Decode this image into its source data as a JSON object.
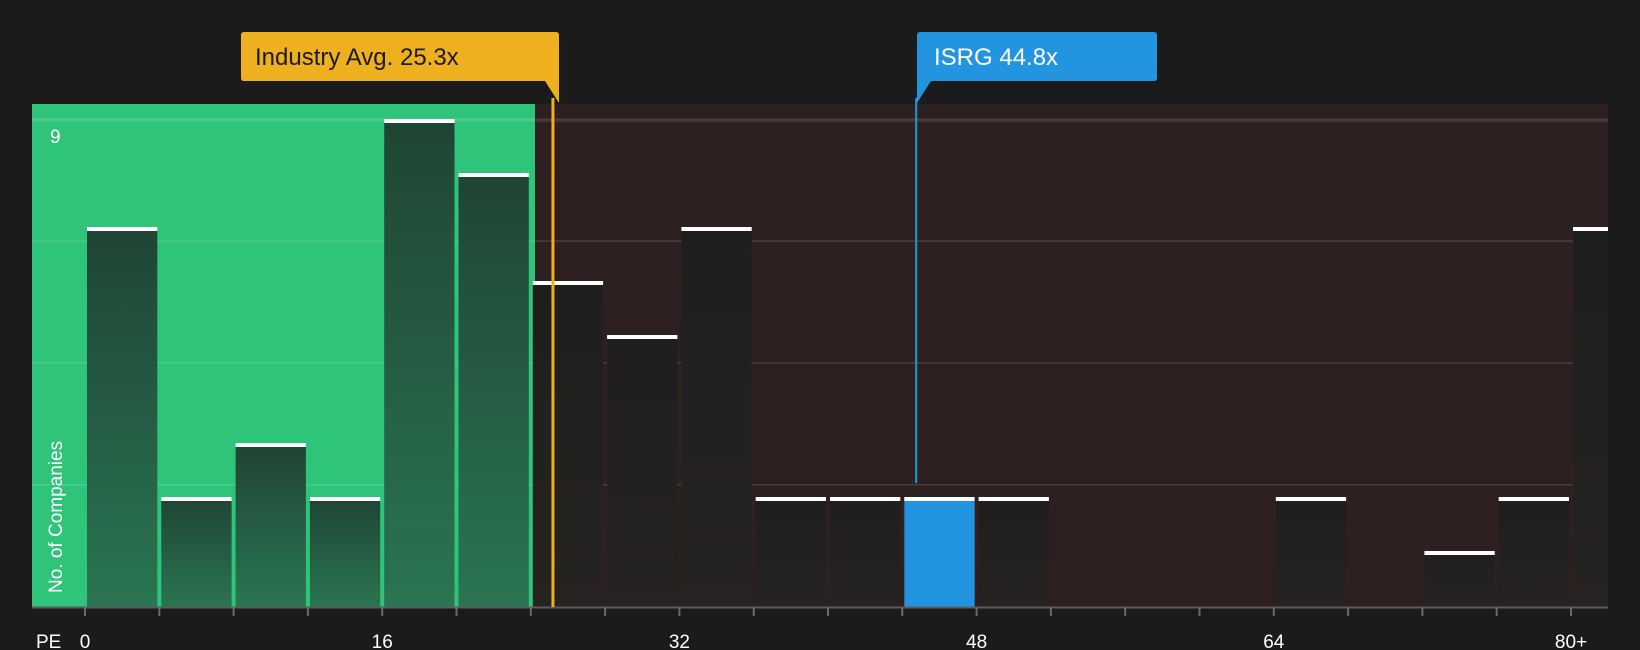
{
  "chart_data": {
    "type": "bar",
    "xlabel": "PE",
    "ylabel": "No. of Companies",
    "x_ticks": [
      "0",
      "16",
      "32",
      "48",
      "64",
      "80+"
    ],
    "y_tick_label": "9",
    "ylim": [
      0,
      9
    ],
    "bin_width": 4,
    "bins": [
      {
        "x0": 0,
        "value": 7
      },
      {
        "x0": 4,
        "value": 2
      },
      {
        "x0": 8,
        "value": 3
      },
      {
        "x0": 12,
        "value": 2
      },
      {
        "x0": 16,
        "value": 9
      },
      {
        "x0": 20,
        "value": 8
      },
      {
        "x0": 24,
        "value": 6
      },
      {
        "x0": 28,
        "value": 5
      },
      {
        "x0": 32,
        "value": 7
      },
      {
        "x0": 36,
        "value": 2
      },
      {
        "x0": 40,
        "value": 2
      },
      {
        "x0": 44,
        "value": 2,
        "highlight": true
      },
      {
        "x0": 48,
        "value": 2
      },
      {
        "x0": 64,
        "value": 2
      },
      {
        "x0": 72,
        "value": 1
      },
      {
        "x0": 76,
        "value": 2
      },
      {
        "x0": 80,
        "value": 7
      }
    ],
    "industry_avg": {
      "label": "Industry Avg. 25.3x",
      "value": 25.3
    },
    "company": {
      "label": "ISRG 44.8x",
      "value": 44.8
    },
    "colors": {
      "background": "#1b1b1b",
      "undervalued_zone": "#2ec47a",
      "overvalued_zone": "#2e1f20",
      "industry": "#eeb01e",
      "company": "#2394e0",
      "bar_green_zone": "#234a38",
      "bar_dark_zone": "#231f1f",
      "cap": "#ffffff"
    }
  }
}
